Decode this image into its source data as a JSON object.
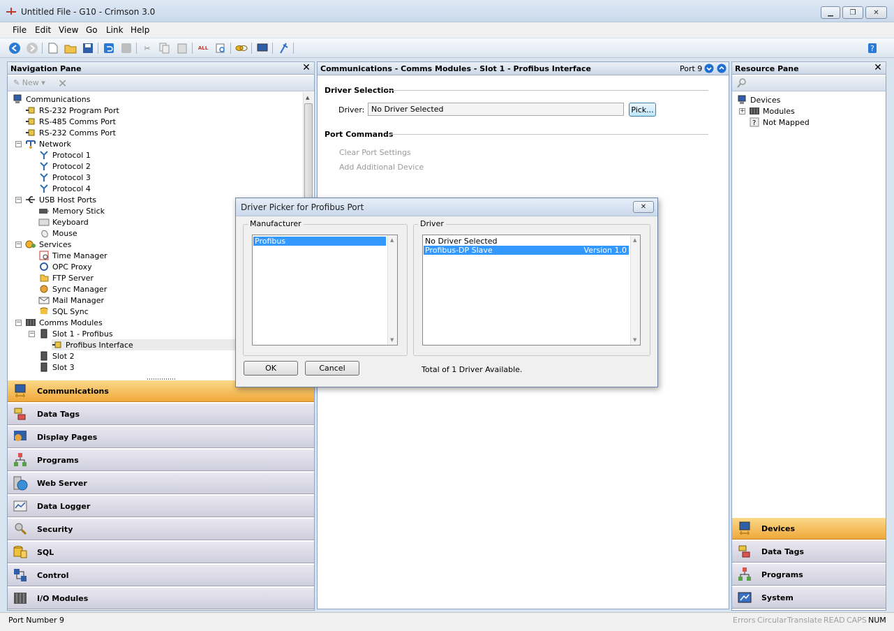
{
  "window": {
    "title": "Untitled File - G10 - Crimson 3.0"
  },
  "menu": [
    "File",
    "Edit",
    "View",
    "Go",
    "Link",
    "Help"
  ],
  "navigation": {
    "title": "Navigation Pane",
    "new_label": "New",
    "tree": [
      {
        "label": "Communications",
        "level": 0,
        "icon": "computer-icon"
      },
      {
        "label": "RS-232 Program Port",
        "level": 1,
        "icon": "port-icon"
      },
      {
        "label": "RS-485 Comms Port",
        "level": 1,
        "icon": "port-icon"
      },
      {
        "label": "RS-232 Comms Port",
        "level": 1,
        "icon": "port-icon"
      },
      {
        "label": "Network",
        "level": 1,
        "icon": "network-icon",
        "expander": "−"
      },
      {
        "label": "Protocol 1",
        "level": 2,
        "icon": "protocol-icon"
      },
      {
        "label": "Protocol 2",
        "level": 2,
        "icon": "protocol-icon"
      },
      {
        "label": "Protocol 3",
        "level": 2,
        "icon": "protocol-icon"
      },
      {
        "label": "Protocol 4",
        "level": 2,
        "icon": "protocol-icon"
      },
      {
        "label": "USB Host Ports",
        "level": 1,
        "icon": "usb-icon",
        "expander": "−"
      },
      {
        "label": "Memory Stick",
        "level": 2,
        "icon": "memory-stick-icon"
      },
      {
        "label": "Keyboard",
        "level": 2,
        "icon": "keyboard-icon"
      },
      {
        "label": "Mouse",
        "level": 2,
        "icon": "mouse-icon"
      },
      {
        "label": "Services",
        "level": 1,
        "icon": "services-icon",
        "expander": "−"
      },
      {
        "label": "Time Manager",
        "level": 2,
        "icon": "clock-icon"
      },
      {
        "label": "OPC Proxy",
        "level": 2,
        "icon": "opc-icon"
      },
      {
        "label": "FTP Server",
        "level": 2,
        "icon": "ftp-icon"
      },
      {
        "label": "Sync Manager",
        "level": 2,
        "icon": "sync-icon"
      },
      {
        "label": "Mail Manager",
        "level": 2,
        "icon": "mail-icon"
      },
      {
        "label": "SQL Sync",
        "level": 2,
        "icon": "sql-sync-icon"
      },
      {
        "label": "Comms Modules",
        "level": 1,
        "icon": "module-rack-icon",
        "expander": "−"
      },
      {
        "label": "Slot 1 - Profibus",
        "level": 2,
        "icon": "module-icon",
        "expander": "−"
      },
      {
        "label": "Profibus Interface",
        "level": 3,
        "icon": "port-icon",
        "selected": true
      },
      {
        "label": "Slot 2",
        "level": 2,
        "icon": "module-icon"
      },
      {
        "label": "Slot 3",
        "level": 2,
        "icon": "module-icon"
      }
    ],
    "categories": [
      {
        "label": "Communications",
        "icon": "communications-icon",
        "active": true
      },
      {
        "label": "Data Tags",
        "icon": "data-tags-icon"
      },
      {
        "label": "Display Pages",
        "icon": "display-pages-icon"
      },
      {
        "label": "Programs",
        "icon": "programs-icon"
      },
      {
        "label": "Web Server",
        "icon": "web-server-icon"
      },
      {
        "label": "Data Logger",
        "icon": "data-logger-icon"
      },
      {
        "label": "Security",
        "icon": "security-icon"
      },
      {
        "label": "SQL",
        "icon": "sql-icon"
      },
      {
        "label": "Control",
        "icon": "control-icon"
      },
      {
        "label": "I/O Modules",
        "icon": "io-modules-icon"
      }
    ]
  },
  "center": {
    "title": "Communications - Comms Modules - Slot 1 - Profibus Interface",
    "port_label": "Port 9",
    "driver_section": "Driver Selection",
    "driver_label": "Driver:",
    "driver_value": "No Driver Selected",
    "pick_button": "Pick...",
    "port_section": "Port Commands",
    "commands": [
      "Clear Port Settings",
      "Add Additional Device"
    ]
  },
  "resource": {
    "title": "Resource Pane",
    "tree": [
      {
        "label": "Devices",
        "level": 0,
        "icon": "computer-icon"
      },
      {
        "label": "Modules",
        "level": 1,
        "icon": "module-rack-icon",
        "expander": "+"
      },
      {
        "label": "Not Mapped",
        "level": 1,
        "icon": "question-icon"
      }
    ],
    "categories": [
      {
        "label": "Devices",
        "icon": "devices-icon",
        "active": true
      },
      {
        "label": "Data Tags",
        "icon": "data-tags-icon"
      },
      {
        "label": "Programs",
        "icon": "programs-icon"
      },
      {
        "label": "System",
        "icon": "system-icon"
      }
    ]
  },
  "status": {
    "left": "Port Number 9",
    "indicators": [
      "Errors",
      "Circular",
      "Translate",
      "READ",
      "CAPS",
      "NUM"
    ]
  },
  "dialog": {
    "title": "Driver Picker for Profibus Port",
    "manufacturer_label": "Manufacturer",
    "manufacturers": [
      "Profibus"
    ],
    "driver_label": "Driver",
    "drivers": [
      {
        "name": "No Driver Selected",
        "version": ""
      },
      {
        "name": "Profibus-DP Slave",
        "version": "Version 1.0",
        "selected": true
      }
    ],
    "ok": "OK",
    "cancel": "Cancel",
    "summary": "Total of 1 Driver Available."
  },
  "colors": {
    "accent": "#f0a93a",
    "selection": "#3399ff"
  }
}
